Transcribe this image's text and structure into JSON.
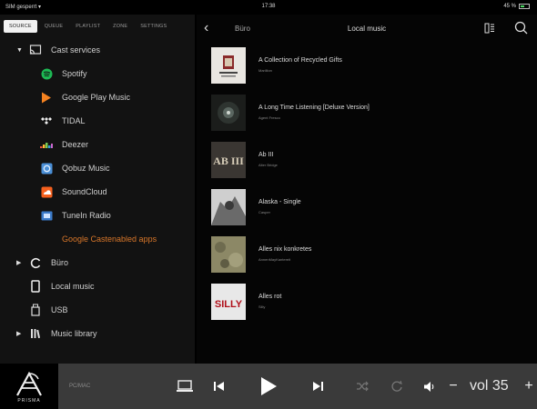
{
  "status": {
    "carrier": "SIM gesperrt",
    "time": "17:38",
    "battery": "45 %"
  },
  "tabs": [
    {
      "label": "SOURCE"
    },
    {
      "label": "QUEUE"
    },
    {
      "label": "PLAYLIST"
    },
    {
      "label": "ZONE"
    },
    {
      "label": "SETTINGS"
    }
  ],
  "sidebar": {
    "cast_services": "Cast services",
    "services": [
      {
        "label": "Spotify",
        "icon": "spotify-icon"
      },
      {
        "label": "Google Play Music",
        "icon": "google-play-music-icon"
      },
      {
        "label": "TIDAL",
        "icon": "tidal-icon"
      },
      {
        "label": "Deezer",
        "icon": "deezer-icon"
      },
      {
        "label": "Qobuz Music",
        "icon": "qobuz-icon"
      },
      {
        "label": "SoundCloud",
        "icon": "soundcloud-icon"
      },
      {
        "label": "TuneIn Radio",
        "icon": "tunein-icon"
      }
    ],
    "cast_apps": "Google Castenabled apps",
    "buero": "Büro",
    "local_music": "Local music",
    "usb": "USB",
    "music_library": "Music library"
  },
  "header": {
    "crumb": "Büro",
    "title": "Local music"
  },
  "albums": [
    {
      "title": "A Collection of Recycled Gifts",
      "artist": "Marillion"
    },
    {
      "title": "A Long Time Listening [Deluxe Version]",
      "artist": "Agent Fresco"
    },
    {
      "title": "Ab III",
      "artist": "Alter Bridge"
    },
    {
      "title": "Alaska - Single",
      "artist": "Casper"
    },
    {
      "title": "Alles nix konkretes",
      "artist": "AnnenMayKantereit"
    },
    {
      "title": "Alles rot",
      "artist": "Silly"
    }
  ],
  "cover_text": {
    "ab3": "AB III",
    "silly": "SILLY"
  },
  "player": {
    "brand": "PRISMA",
    "source": "PC/MAC",
    "volume": "vol 35",
    "minus": "−",
    "plus": "+"
  },
  "colors": {
    "accent_orange": "#d9772a",
    "player_bar": "#3a3a3a"
  }
}
